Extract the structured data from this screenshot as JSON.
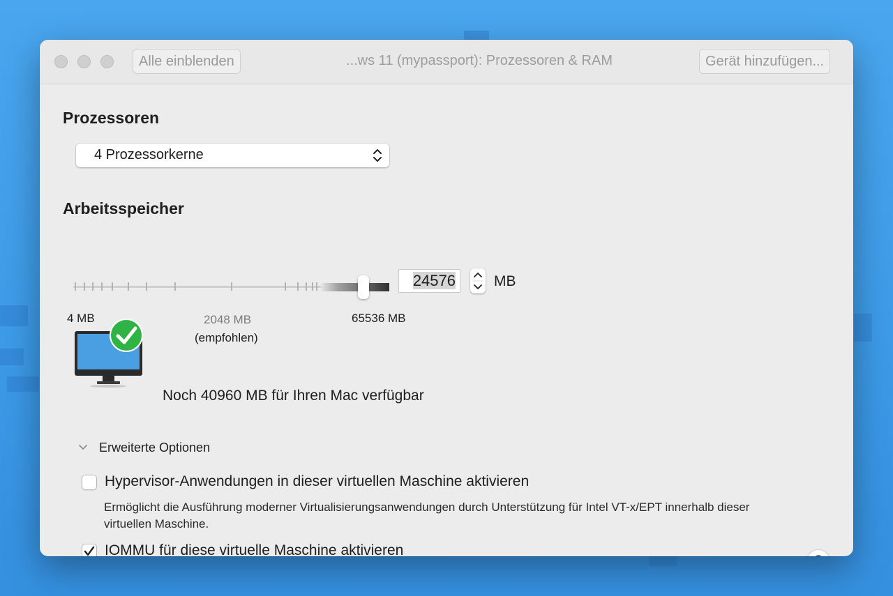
{
  "window": {
    "title": "...ws 11 (mypassport): Prozessoren & RAM",
    "show_all_button": "Alle einblenden",
    "add_device_button": "Gerät hinzufügen..."
  },
  "processors": {
    "heading": "Prozessoren",
    "selected": "4 Prozessorkerne"
  },
  "memory": {
    "heading": "Arbeitsspeicher",
    "value": "24576",
    "unit": "MB",
    "slider_min_label": "4 MB",
    "recommended_value_label": "2048 MB",
    "recommended_label": "(empfohlen)",
    "slider_max_label": "65536 MB",
    "available_text": "Noch 40960 MB für Ihren Mac verfügbar"
  },
  "advanced": {
    "toggle_label": "Erweiterte Optionen",
    "hypervisor": {
      "label": "Hypervisor-Anwendungen in dieser virtuellen Maschine aktivieren",
      "checked": false,
      "description": "Ermöglicht die Ausführung moderner Virtualisierungsanwendungen durch Unterstützung für Intel VT-x/EPT innerhalb dieser virtuellen Maschine."
    },
    "iommu": {
      "label": "IOMMU für diese virtuelle Maschine aktivieren",
      "checked": true
    }
  },
  "help_button": "?",
  "icons": {
    "mac": "imac-icon",
    "check_badge": "checkmark-badge-icon",
    "popup_chevrons": "up-down-chevron-icon",
    "stepper": "stepper-arrows-icon",
    "disclosure": "chevron-down-icon",
    "checkmark": "checkmark-icon"
  },
  "colors": {
    "accent_green": "#2fb344",
    "background_blue": "#3f9ce8"
  }
}
